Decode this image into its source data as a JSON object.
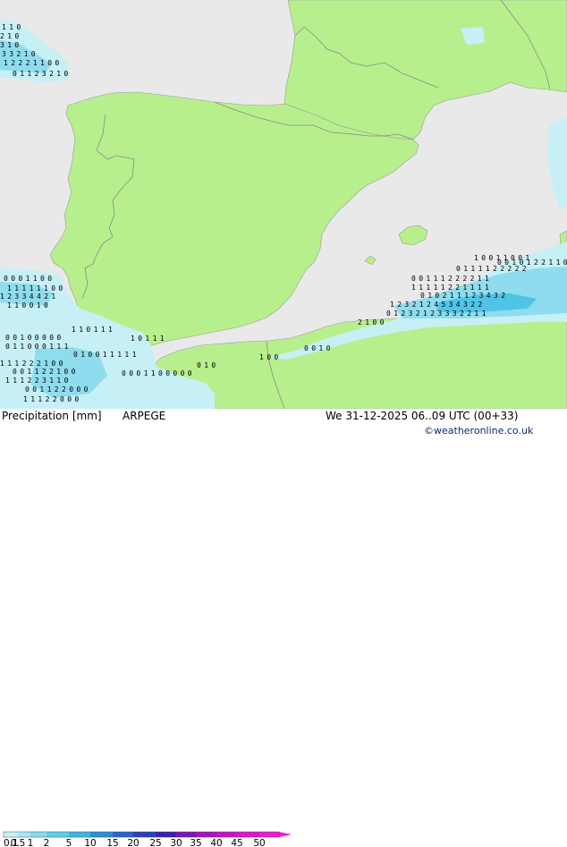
{
  "header": {
    "left_title": "Precipitation [mm]",
    "model": "ARPEGE",
    "valid_time": "We 31-12-2025 06..09 UTC (00+33)",
    "credit": "©weatheronline.co.uk"
  },
  "legend": {
    "ticks": [
      "0.1",
      "0.5",
      "1",
      "2",
      "5",
      "10",
      "15",
      "20",
      "25",
      "30",
      "35",
      "40",
      "45",
      "50"
    ],
    "colors": [
      "#c7f0f7",
      "#a6e6f3",
      "#85dcef",
      "#5fcdea",
      "#3bb7e1",
      "#2a8fd6",
      "#2b63c9",
      "#2a3fbd",
      "#3a22b3",
      "#7a16b8",
      "#a514c0",
      "#c514c8",
      "#e014c8",
      "#f01cd4"
    ]
  },
  "map_colors": {
    "land": "#b7ef8d",
    "sea": "#e9e9e9",
    "precip_light": "#c6f0f6",
    "precip_mid": "#8fdcee",
    "precip_heavy": "#4fc4e6",
    "border": "#8a8a8a"
  },
  "precip_values": [
    [
      "1",
      "1",
      "0"
    ],
    [
      "2",
      "1",
      "0"
    ],
    [
      "3",
      "1",
      "0"
    ],
    [
      "3",
      "3",
      "2",
      "1",
      "0"
    ],
    [
      "1",
      "2",
      "2",
      "2",
      "1",
      "1",
      "0",
      "0"
    ],
    [
      "0",
      "1",
      "1",
      "2",
      "3",
      "2",
      "1",
      "0"
    ],
    [
      "0",
      "0",
      "0",
      "1",
      "1",
      "0",
      "0"
    ],
    [
      "1",
      "1",
      "1",
      "1",
      "1",
      "1",
      "0",
      "0"
    ],
    [
      "1",
      "2",
      "3",
      "3",
      "4",
      "4",
      "2",
      "1"
    ],
    [
      "1",
      "1",
      "0",
      "0",
      "1",
      "0"
    ],
    [
      "0",
      "0",
      "1",
      "0",
      "0",
      "0",
      "0",
      "0"
    ],
    [
      "1",
      "1",
      "0",
      "1",
      "1",
      "1"
    ],
    [
      "0",
      "1",
      "1",
      "0",
      "0",
      "0",
      "1",
      "1",
      "1"
    ],
    [
      "1",
      "1",
      "1",
      "2",
      "2",
      "2",
      "1",
      "0",
      "0"
    ],
    [
      "0",
      "0",
      "1",
      "1",
      "2",
      "2",
      "1",
      "0",
      "0"
    ],
    [
      "1",
      "1",
      "1",
      "2",
      "2",
      "3",
      "1",
      "1",
      "0"
    ],
    [
      "0",
      "0",
      "1",
      "1",
      "2",
      "2",
      "0",
      "0",
      "0"
    ],
    [
      "1",
      "1",
      "1",
      "2",
      "2",
      "0",
      "0",
      "0"
    ],
    [
      "0",
      "1",
      "0",
      "0",
      "1",
      "1",
      "1",
      "1",
      "1"
    ],
    [
      "0",
      "0",
      "0",
      "1",
      "1",
      "0",
      "0",
      "0",
      "0",
      "0"
    ],
    [
      "1",
      "1",
      "1",
      "1",
      "1",
      "2",
      "2",
      "1",
      "1",
      "1",
      "1"
    ],
    [
      "0",
      "0",
      "1",
      "1",
      "1",
      "2",
      "2",
      "2",
      "2",
      "1",
      "1"
    ],
    [
      "0",
      "1",
      "0",
      "2",
      "1",
      "1",
      "1",
      "2",
      "3",
      "4",
      "3",
      "2"
    ],
    [
      "1",
      "2",
      "3",
      "2",
      "1",
      "2",
      "4",
      "5",
      "3",
      "4",
      "3",
      "2",
      "2"
    ],
    [
      "0",
      "1",
      "2",
      "3",
      "2",
      "1",
      "2",
      "3",
      "3",
      "3",
      "2",
      "2",
      "1",
      "1"
    ],
    [
      "0",
      "1",
      "1",
      "1",
      "1",
      "2",
      "2",
      "2",
      "2",
      "2"
    ],
    [
      "1",
      "0",
      "0",
      "1",
      "1",
      "0",
      "0",
      "1"
    ],
    [
      "0",
      "0",
      "1",
      "0",
      "1",
      "2",
      "2",
      "1",
      "1",
      "0"
    ],
    [
      "1",
      "0",
      "1",
      "1",
      "1"
    ],
    [
      "2",
      "1",
      "0",
      "0"
    ],
    [
      "0",
      "0",
      "1",
      "0"
    ],
    [
      "1",
      "0",
      "0"
    ],
    [
      "0",
      "1",
      "0"
    ]
  ]
}
